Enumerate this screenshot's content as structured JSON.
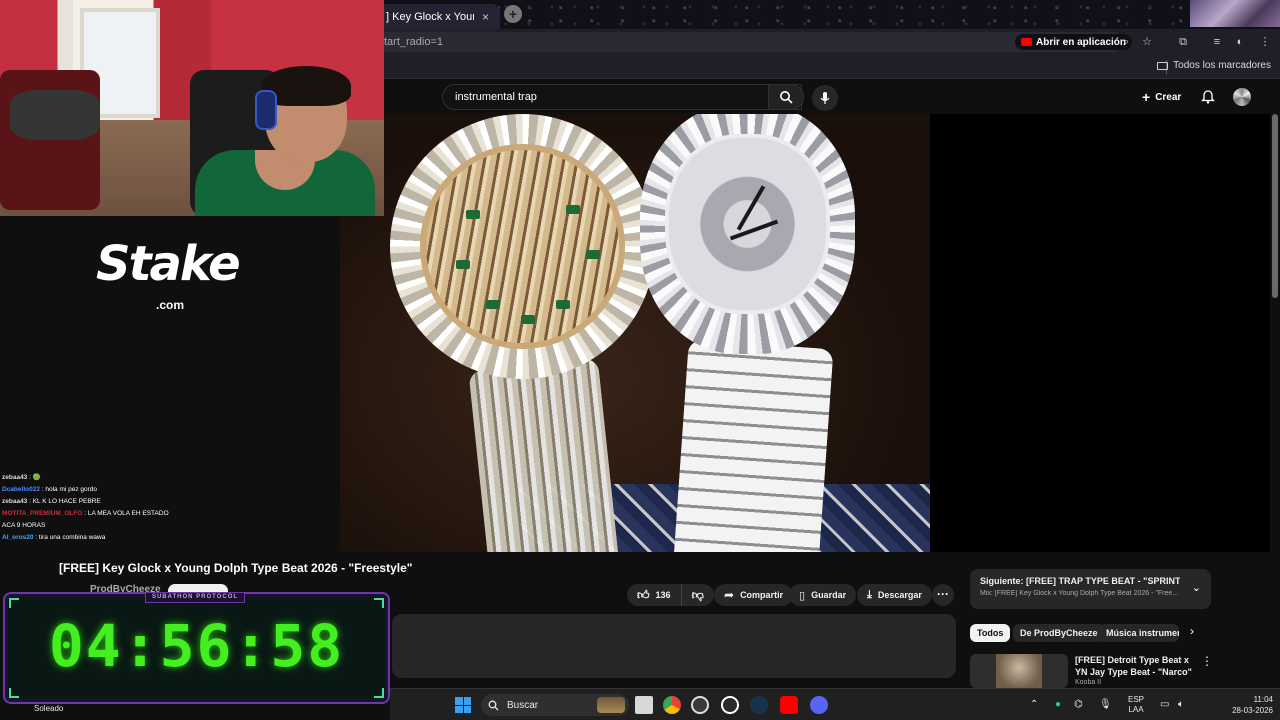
{
  "browser": {
    "tab_title": "] Key Glock x Young Dolph",
    "tab_close": "×",
    "new_tab": "+",
    "url_fragment": "tart_radio=1",
    "open_in_app": "Abrir en aplicación",
    "all_bookmarks": "Todos los marcadores"
  },
  "youtube": {
    "search_value": "instrumental trap",
    "clear_icon": "×",
    "create_label": "Crear",
    "video_title": "[FREE] Key Glock x Young Dolph Type Beat 2026 - \"Freestyle\"",
    "channel_name": "ProdByCheeze",
    "likes": "136",
    "share_label": "Compartir",
    "save_label": "Guardar",
    "download_label": "Descargar",
    "more_label": "···",
    "next_up": {
      "line1": "Siguiente: [FREE] TRAP TYPE BEAT - \"SPRINTER\" | F...",
      "line2": "Mix: [FREE] Key Glock x Young Dolph Type Beat 2026 - \"Free..."
    },
    "chips": [
      "Todos",
      "De ProdByCheeze",
      "Música instrumental"
    ],
    "recommendation": {
      "title": "[FREE] Detroit Type Beat x YN Jay Type Beat - \"Narco\"",
      "channel": "Kooba II",
      "menu": "⋮"
    }
  },
  "stream": {
    "sponsor_word": "Stake",
    "sponsor_tld": ".com",
    "chat": [
      {
        "user": "zebaa43",
        "msg": " : 🟢",
        "color": "#d8d8d8"
      },
      {
        "user": "Dcabello022",
        "msg": " : hola mi pez gordo",
        "color": "#4a8cff"
      },
      {
        "user": "zebaa43",
        "msg": " : KL K LO HACE PEBRE",
        "color": "#d8d8d8"
      },
      {
        "user": "MOTITA_PREMIUM_OLFG",
        "msg": " : LA MEA VOLA EH ESTADO",
        "color": "#c0303a"
      },
      {
        "user": "",
        "msg": "ACA 9 HORAS",
        "color": "#ffffff"
      },
      {
        "user": "Al_oros20",
        "msg": " : tira una combina wawa",
        "color": "#4aa8ff"
      }
    ],
    "timer_label": "SUBATHON PROTOCOL",
    "timer_value": "04:56:58",
    "weather": "Soleado"
  },
  "taskbar": {
    "search_label": "Buscar",
    "language_top": "ESP",
    "language_bottom": "LAA",
    "time": "11:04",
    "date": "28-03-2026"
  },
  "colors": {
    "yt_red": "#ff0000",
    "timer_green": "#43ef1e",
    "timer_border": "#6b3aa6"
  }
}
